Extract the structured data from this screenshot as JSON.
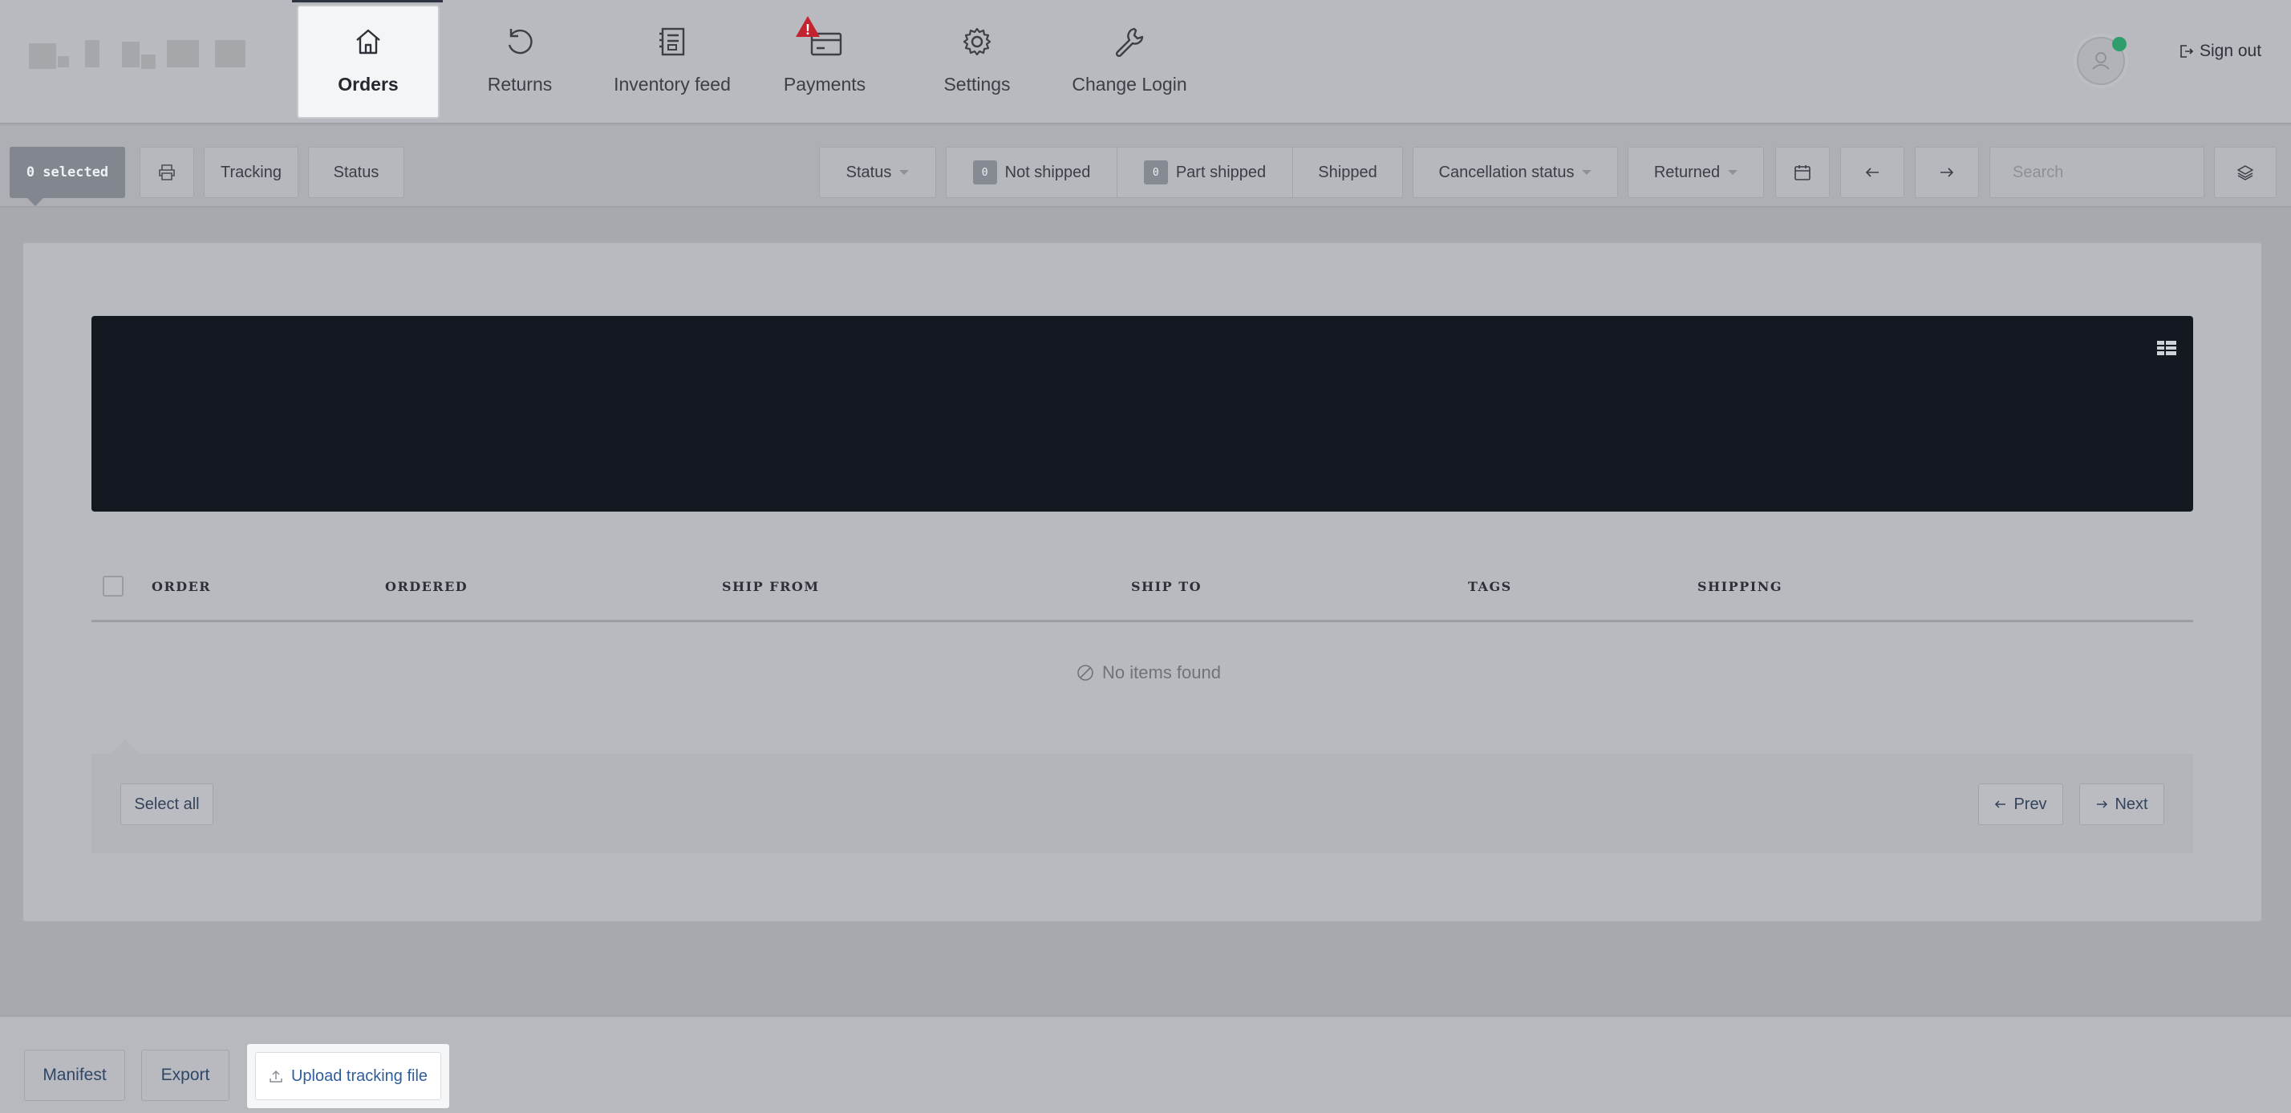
{
  "nav": {
    "items": [
      {
        "label": "Orders",
        "icon": "home-icon",
        "active": true
      },
      {
        "label": "Returns",
        "icon": "undo-icon",
        "active": false
      },
      {
        "label": "Inventory feed",
        "icon": "feed-icon",
        "active": false
      },
      {
        "label": "Payments",
        "icon": "payments-icon",
        "active": false,
        "alert": "!"
      },
      {
        "label": "Settings",
        "icon": "gear-icon",
        "active": false
      },
      {
        "label": "Change Login",
        "icon": "wrench-icon",
        "active": false
      }
    ],
    "sign_out": "Sign out"
  },
  "toolbar": {
    "selected": "0 selected",
    "tracking": "Tracking",
    "status": "Status",
    "status_filter": "Status",
    "not_shipped_count": "0",
    "not_shipped": "Not shipped",
    "part_shipped_count": "0",
    "part_shipped": "Part shipped",
    "shipped": "Shipped",
    "cancellation_status": "Cancellation status",
    "returned": "Returned",
    "search_placeholder": "Search"
  },
  "table": {
    "columns": [
      "ORDER",
      "ORDERED",
      "SHIP FROM",
      "SHIP TO",
      "TAGS",
      "SHIPPING"
    ],
    "empty_message": "No items found"
  },
  "pagination": {
    "select_all": "Select all",
    "prev": "Prev",
    "next": "Next"
  },
  "bottom": {
    "manifest": "Manifest",
    "export": "Export",
    "upload_tracking": "Upload tracking file"
  },
  "colors": {
    "accent": "#2f5d9a",
    "alert": "#c2232e",
    "online": "#2f9e6d",
    "banner": "#131821"
  }
}
